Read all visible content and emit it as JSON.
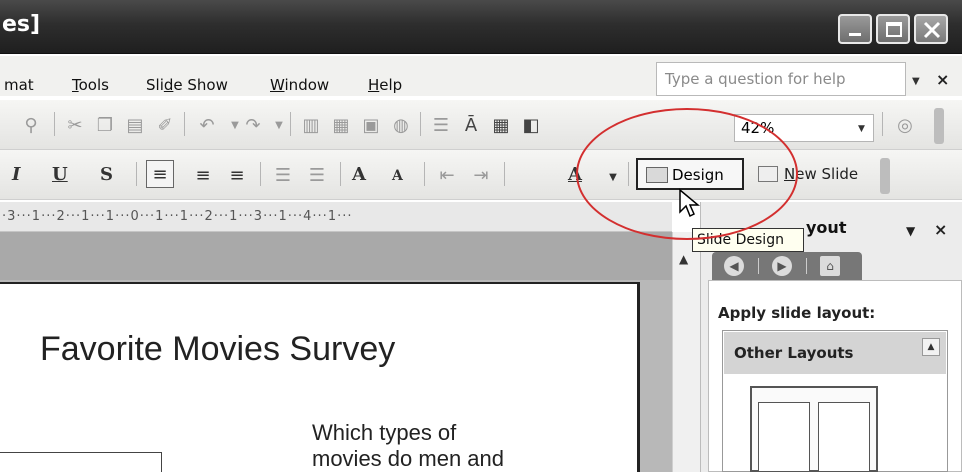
{
  "window": {
    "title_fragment": "es]"
  },
  "menu": {
    "items": [
      {
        "pre": "",
        "u": "",
        "post": "mat"
      },
      {
        "pre": "",
        "u": "T",
        "post": "ools"
      },
      {
        "pre": "Sli",
        "u": "d",
        "post": "e Show"
      },
      {
        "pre": "",
        "u": "W",
        "post": "indow"
      },
      {
        "pre": "",
        "u": "H",
        "post": "elp"
      }
    ],
    "help_placeholder": "Type a question for help",
    "help_close": "×"
  },
  "toolbar": {
    "zoom": "42%"
  },
  "formatting": {
    "italic": "I",
    "underline": "U",
    "shadow": "S",
    "increase_font": "A",
    "decrease_font": "A",
    "font_color": "A",
    "design_label": "Design",
    "new_slide_pre": "",
    "new_slide_u": "N",
    "new_slide_post": "ew Slide"
  },
  "ruler": {
    "text": "·3···1···2···1···1···0···1···1···2···1···3···1···4···1···"
  },
  "slide": {
    "title": "Favorite Movies Survey",
    "body_line1": "Which types of",
    "body_line2": "movies do men and"
  },
  "taskpane": {
    "title": "yout",
    "close": "×",
    "apply_label": "Apply slide layout:",
    "section_label": "Other Layouts"
  },
  "tooltip": {
    "text": "Slide Design"
  }
}
